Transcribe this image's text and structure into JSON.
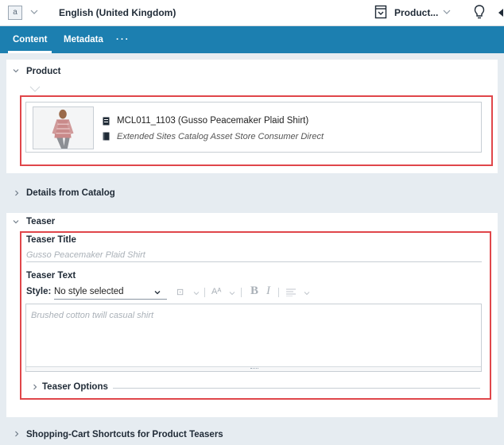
{
  "toolbar": {
    "language_icon": "language-flag-icon",
    "language_label": "English (United Kingdom)",
    "product_icon": "product-doc-icon",
    "product_label": "Product...",
    "bulb_icon": "lightbulb-icon"
  },
  "tabs": [
    {
      "label": "Content",
      "active": true
    },
    {
      "label": "Metadata",
      "active": false
    },
    {
      "label": "···",
      "active": false
    }
  ],
  "product_section": {
    "title": "Product",
    "expanded": true,
    "item": {
      "name": "MCL011_1103 (Gusso Peacemaker Plaid Shirt)",
      "catalog": "Extended Sites Catalog Asset Store Consumer Direct"
    }
  },
  "details_section": {
    "title": "Details from Catalog",
    "expanded": false
  },
  "teaser_section": {
    "title": "Teaser",
    "expanded": true,
    "teaser_title_label": "Teaser Title",
    "teaser_title_value": "Gusso Peacemaker Plaid Shirt",
    "teaser_text_label": "Teaser Text",
    "style_label": "Style:",
    "style_value": "No style selected",
    "teaser_text_placeholder": "Brushed cotton twill casual shirt",
    "options_label": "Teaser Options"
  },
  "shortcuts_section": {
    "title": "Shopping-Cart Shortcuts for Product Teasers",
    "expanded": false
  },
  "colors": {
    "accent": "#1c7fb0",
    "highlight": "#e0464a",
    "background": "#e6ecf1"
  }
}
